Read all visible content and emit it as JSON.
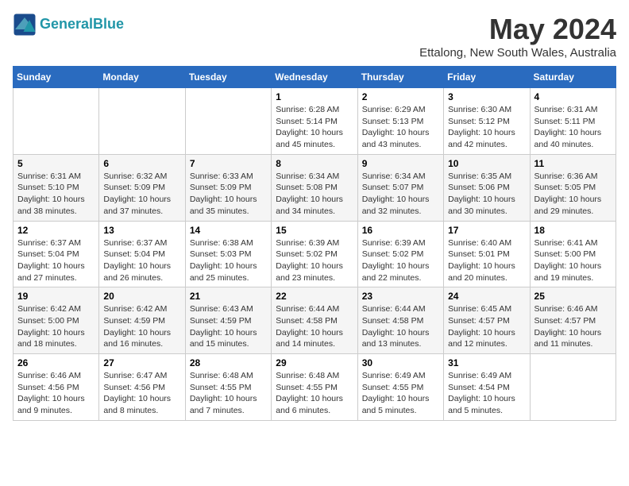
{
  "logo": {
    "line1": "General",
    "line2": "Blue"
  },
  "title": "May 2024",
  "subtitle": "Ettalong, New South Wales, Australia",
  "days_of_week": [
    "Sunday",
    "Monday",
    "Tuesday",
    "Wednesday",
    "Thursday",
    "Friday",
    "Saturday"
  ],
  "weeks": [
    [
      {
        "day": "",
        "info": ""
      },
      {
        "day": "",
        "info": ""
      },
      {
        "day": "",
        "info": ""
      },
      {
        "day": "1",
        "info": "Sunrise: 6:28 AM\nSunset: 5:14 PM\nDaylight: 10 hours\nand 45 minutes."
      },
      {
        "day": "2",
        "info": "Sunrise: 6:29 AM\nSunset: 5:13 PM\nDaylight: 10 hours\nand 43 minutes."
      },
      {
        "day": "3",
        "info": "Sunrise: 6:30 AM\nSunset: 5:12 PM\nDaylight: 10 hours\nand 42 minutes."
      },
      {
        "day": "4",
        "info": "Sunrise: 6:31 AM\nSunset: 5:11 PM\nDaylight: 10 hours\nand 40 minutes."
      }
    ],
    [
      {
        "day": "5",
        "info": "Sunrise: 6:31 AM\nSunset: 5:10 PM\nDaylight: 10 hours\nand 38 minutes."
      },
      {
        "day": "6",
        "info": "Sunrise: 6:32 AM\nSunset: 5:09 PM\nDaylight: 10 hours\nand 37 minutes."
      },
      {
        "day": "7",
        "info": "Sunrise: 6:33 AM\nSunset: 5:09 PM\nDaylight: 10 hours\nand 35 minutes."
      },
      {
        "day": "8",
        "info": "Sunrise: 6:34 AM\nSunset: 5:08 PM\nDaylight: 10 hours\nand 34 minutes."
      },
      {
        "day": "9",
        "info": "Sunrise: 6:34 AM\nSunset: 5:07 PM\nDaylight: 10 hours\nand 32 minutes."
      },
      {
        "day": "10",
        "info": "Sunrise: 6:35 AM\nSunset: 5:06 PM\nDaylight: 10 hours\nand 30 minutes."
      },
      {
        "day": "11",
        "info": "Sunrise: 6:36 AM\nSunset: 5:05 PM\nDaylight: 10 hours\nand 29 minutes."
      }
    ],
    [
      {
        "day": "12",
        "info": "Sunrise: 6:37 AM\nSunset: 5:04 PM\nDaylight: 10 hours\nand 27 minutes."
      },
      {
        "day": "13",
        "info": "Sunrise: 6:37 AM\nSunset: 5:04 PM\nDaylight: 10 hours\nand 26 minutes."
      },
      {
        "day": "14",
        "info": "Sunrise: 6:38 AM\nSunset: 5:03 PM\nDaylight: 10 hours\nand 25 minutes."
      },
      {
        "day": "15",
        "info": "Sunrise: 6:39 AM\nSunset: 5:02 PM\nDaylight: 10 hours\nand 23 minutes."
      },
      {
        "day": "16",
        "info": "Sunrise: 6:39 AM\nSunset: 5:02 PM\nDaylight: 10 hours\nand 22 minutes."
      },
      {
        "day": "17",
        "info": "Sunrise: 6:40 AM\nSunset: 5:01 PM\nDaylight: 10 hours\nand 20 minutes."
      },
      {
        "day": "18",
        "info": "Sunrise: 6:41 AM\nSunset: 5:00 PM\nDaylight: 10 hours\nand 19 minutes."
      }
    ],
    [
      {
        "day": "19",
        "info": "Sunrise: 6:42 AM\nSunset: 5:00 PM\nDaylight: 10 hours\nand 18 minutes."
      },
      {
        "day": "20",
        "info": "Sunrise: 6:42 AM\nSunset: 4:59 PM\nDaylight: 10 hours\nand 16 minutes."
      },
      {
        "day": "21",
        "info": "Sunrise: 6:43 AM\nSunset: 4:59 PM\nDaylight: 10 hours\nand 15 minutes."
      },
      {
        "day": "22",
        "info": "Sunrise: 6:44 AM\nSunset: 4:58 PM\nDaylight: 10 hours\nand 14 minutes."
      },
      {
        "day": "23",
        "info": "Sunrise: 6:44 AM\nSunset: 4:58 PM\nDaylight: 10 hours\nand 13 minutes."
      },
      {
        "day": "24",
        "info": "Sunrise: 6:45 AM\nSunset: 4:57 PM\nDaylight: 10 hours\nand 12 minutes."
      },
      {
        "day": "25",
        "info": "Sunrise: 6:46 AM\nSunset: 4:57 PM\nDaylight: 10 hours\nand 11 minutes."
      }
    ],
    [
      {
        "day": "26",
        "info": "Sunrise: 6:46 AM\nSunset: 4:56 PM\nDaylight: 10 hours\nand 9 minutes."
      },
      {
        "day": "27",
        "info": "Sunrise: 6:47 AM\nSunset: 4:56 PM\nDaylight: 10 hours\nand 8 minutes."
      },
      {
        "day": "28",
        "info": "Sunrise: 6:48 AM\nSunset: 4:55 PM\nDaylight: 10 hours\nand 7 minutes."
      },
      {
        "day": "29",
        "info": "Sunrise: 6:48 AM\nSunset: 4:55 PM\nDaylight: 10 hours\nand 6 minutes."
      },
      {
        "day": "30",
        "info": "Sunrise: 6:49 AM\nSunset: 4:55 PM\nDaylight: 10 hours\nand 5 minutes."
      },
      {
        "day": "31",
        "info": "Sunrise: 6:49 AM\nSunset: 4:54 PM\nDaylight: 10 hours\nand 5 minutes."
      },
      {
        "day": "",
        "info": ""
      }
    ]
  ]
}
